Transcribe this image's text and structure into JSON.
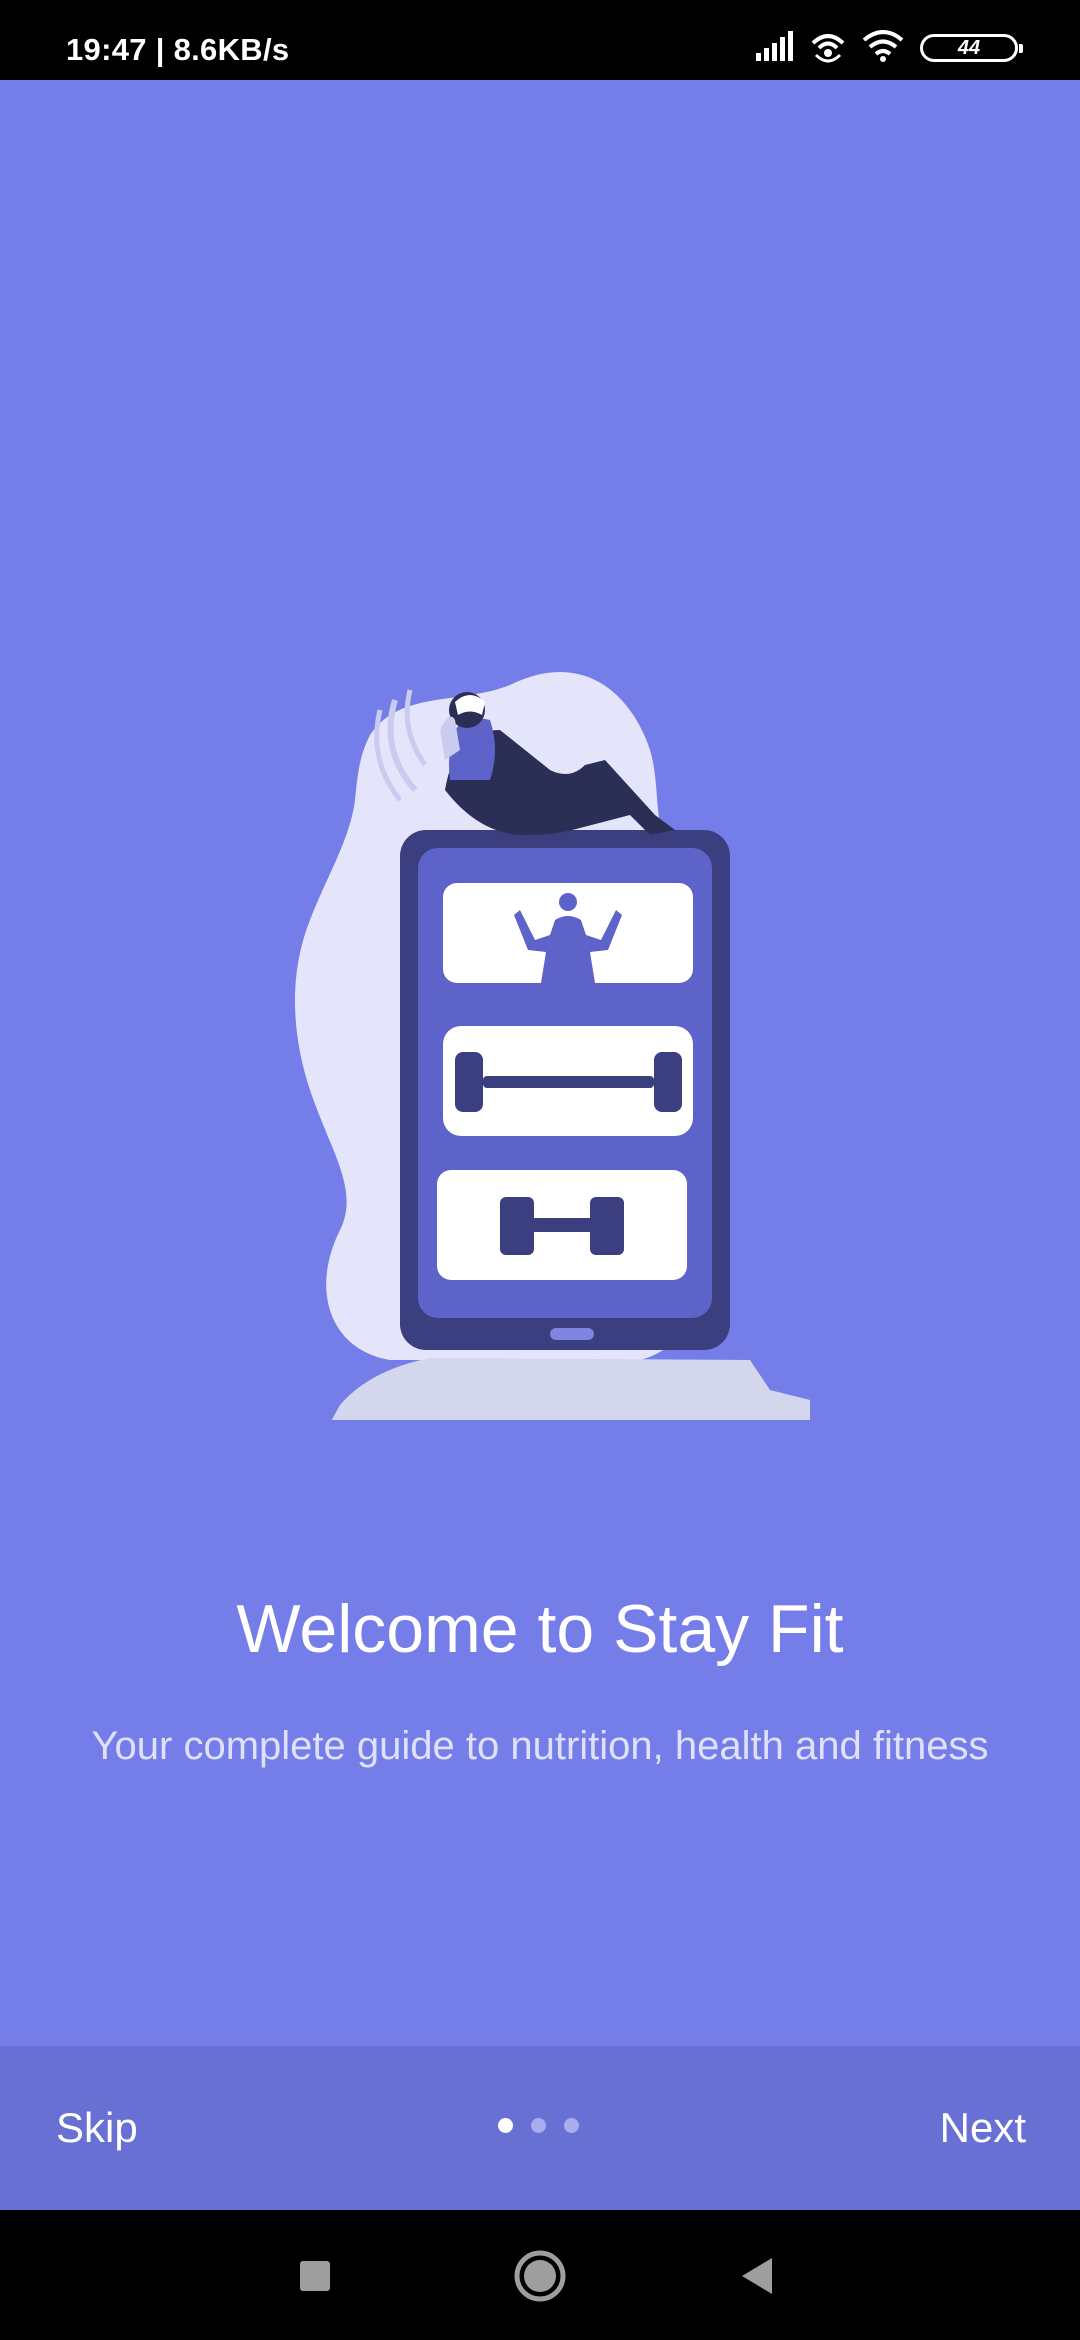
{
  "status_bar": {
    "time_speed": "19:47 | 8.6KB/s",
    "battery_level": "44",
    "icons": [
      "signal-icon",
      "hotspot-icon",
      "wifi-icon",
      "battery-icon"
    ]
  },
  "onboarding": {
    "title": "Welcome to Stay Fit",
    "subtitle": "Your complete guide to nutrition, health and fitness",
    "skip_label": "Skip",
    "next_label": "Next",
    "page_count": 3,
    "current_page": 1
  },
  "navigation": {
    "icons": [
      "recent-apps-icon",
      "home-icon",
      "back-icon"
    ]
  },
  "colors": {
    "background": "#757de8",
    "bottom_bar": "#6970d4",
    "phone_frame": "#3b3f80",
    "accent": "#5d63c9"
  }
}
